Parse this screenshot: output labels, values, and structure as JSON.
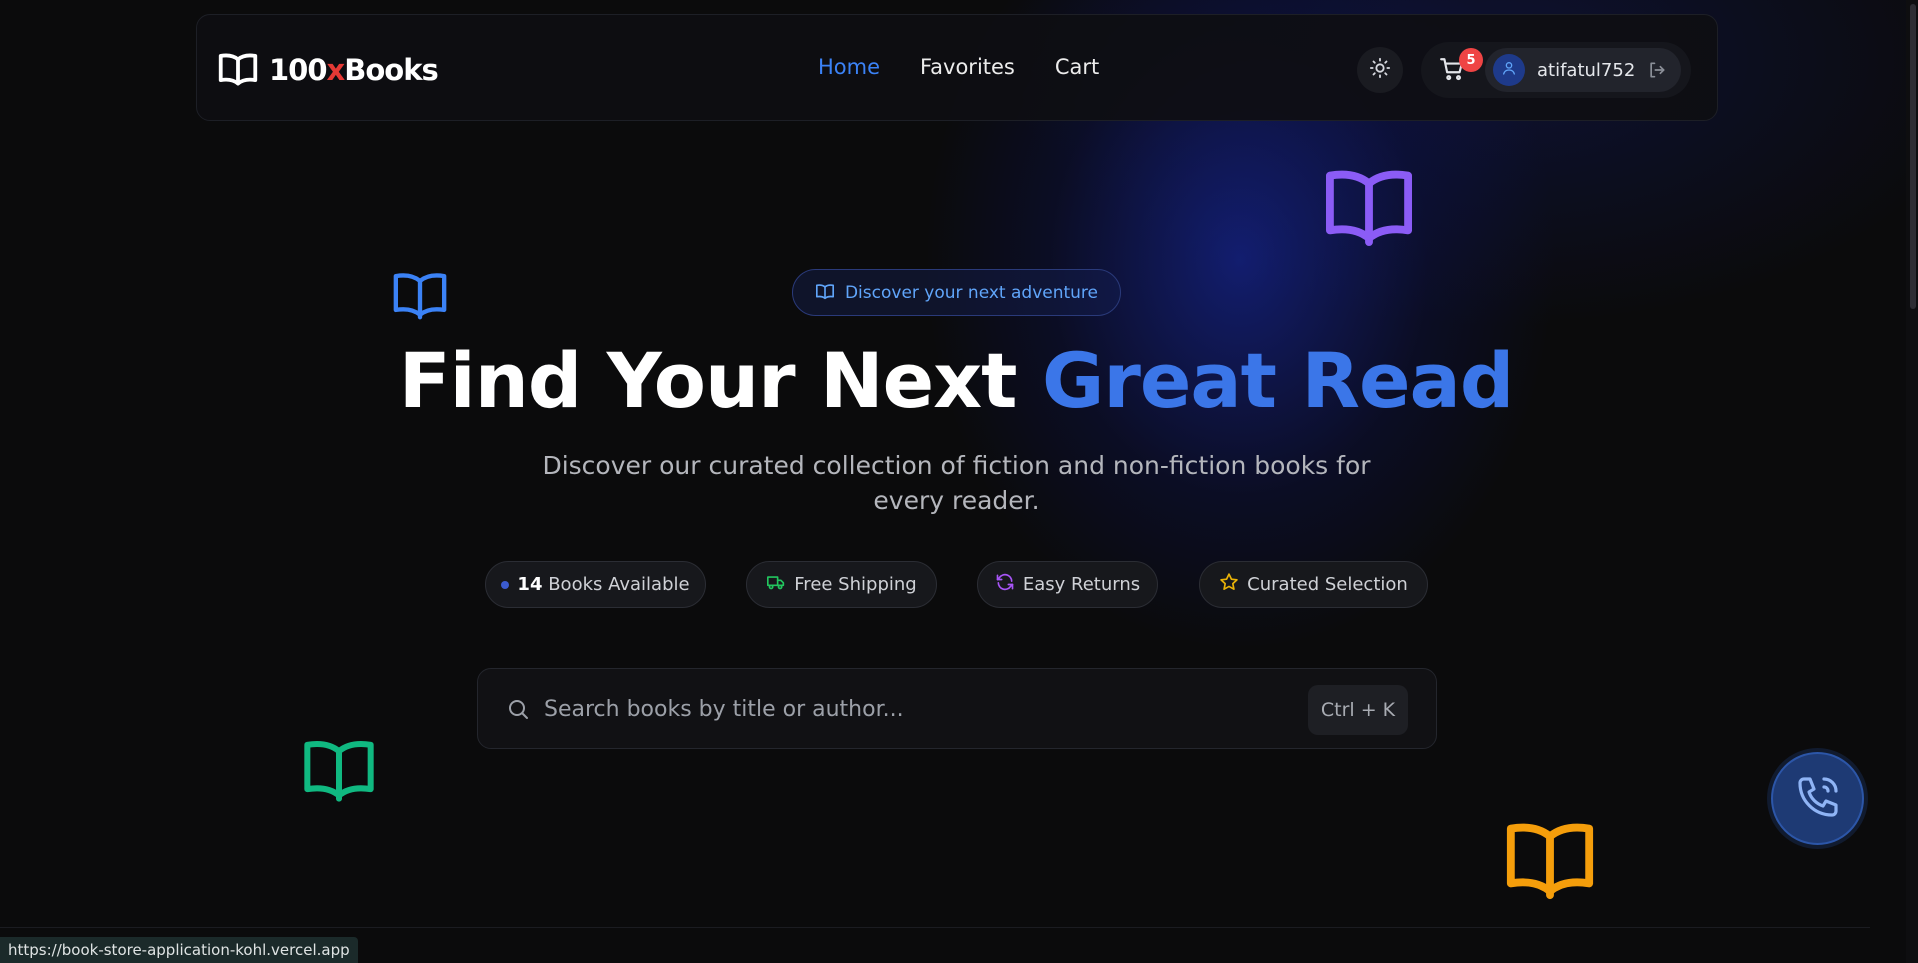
{
  "header": {
    "logo": {
      "prefix": "100",
      "x": "x",
      "suffix": "Books"
    },
    "nav": [
      {
        "label": "Home",
        "active": true
      },
      {
        "label": "Favorites",
        "active": false
      },
      {
        "label": "Cart",
        "active": false
      }
    ],
    "cart_count": "5",
    "username": "atifatul752"
  },
  "hero": {
    "badge": "Discover your next adventure",
    "title_main": "Find Your Next ",
    "title_accent": "Great Read",
    "subtitle": "Discover our curated collection of fiction and non-fiction books for every reader."
  },
  "features": {
    "books_count": "14",
    "books_label": " Books Available",
    "shipping": "Free Shipping",
    "returns": "Easy Returns",
    "curated": "Curated Selection"
  },
  "search": {
    "placeholder": "Search books by title or author...",
    "value": "",
    "shortcut": "Ctrl + K"
  },
  "status_bar": {
    "url": "https://book-store-application-kohl.vercel.app"
  },
  "colors": {
    "accent": "#3b82f6",
    "title_accent": "#3b76e8",
    "brand_x": "#e53935",
    "badge_red": "#ef4444",
    "book_purple": "#8b5cf6",
    "book_blue": "#3b82f6",
    "book_green": "#10b981",
    "book_orange": "#f59e0b"
  },
  "icons": [
    "book-open-icon",
    "sun-icon",
    "cart-icon",
    "user-icon",
    "logout-icon",
    "truck-icon",
    "refresh-icon",
    "star-icon",
    "search-icon",
    "phone-icon"
  ]
}
